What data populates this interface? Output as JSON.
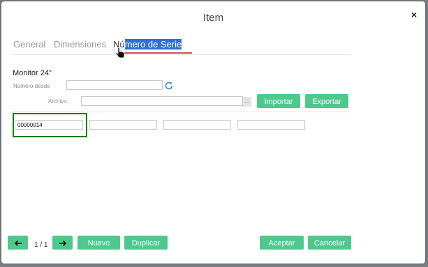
{
  "dialog": {
    "title": "Item",
    "close_label": "×"
  },
  "tabs": [
    {
      "label": "General"
    },
    {
      "label": "Dimensiones"
    },
    {
      "label_prefix": "Nú",
      "label_selected": "mero de Serie"
    }
  ],
  "item": {
    "name": "Monitor 24\"",
    "numero_desde_label": "Número desde",
    "numero_desde_value": "",
    "archivo_label": "Archivo",
    "archivo_value": "",
    "archivo_browse": "..."
  },
  "buttons": {
    "importar": "Importar",
    "exportar": "Exportar",
    "nuevo": "Nuevo",
    "duplicar": "Duplicar",
    "aceptar": "Aceptar",
    "cancelar": "Cancelar",
    "prev_icon": "arrow-left-icon",
    "next_icon": "arrow-right-icon"
  },
  "serials": [
    "00000014",
    "",
    "",
    ""
  ],
  "pager": {
    "text": "1 / 1"
  },
  "colors": {
    "accent": "#4ec98e",
    "tab_underline": "#e04e4e",
    "selection": "#2f6fd6",
    "focus_frame": "#1f7a1f"
  }
}
